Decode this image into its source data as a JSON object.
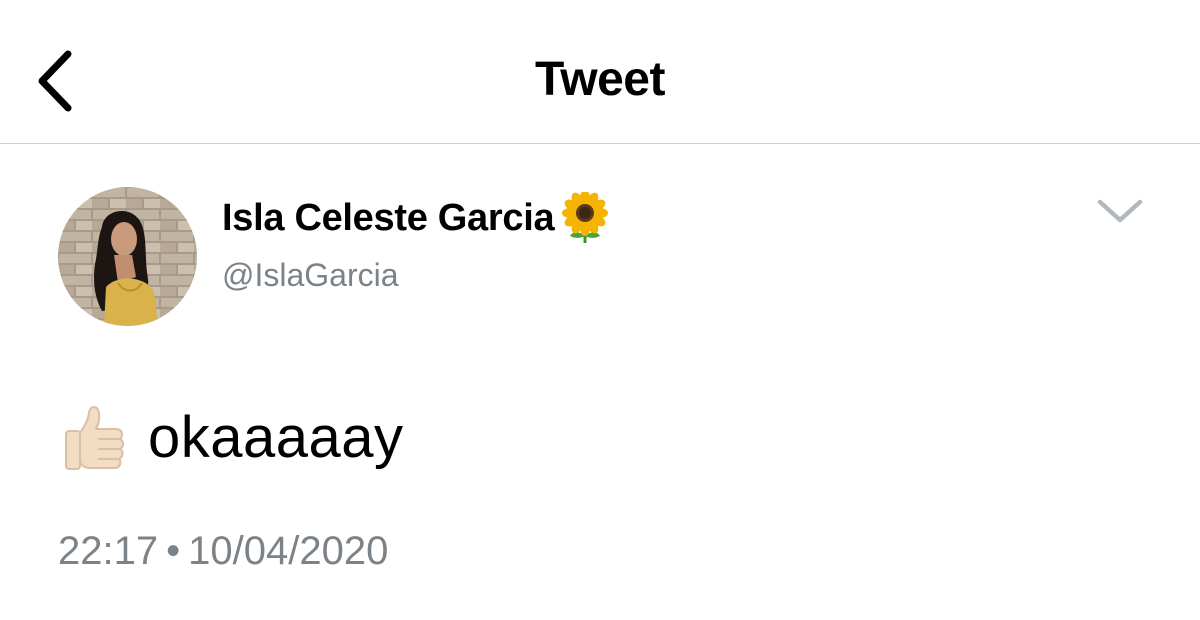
{
  "header": {
    "back_icon": "chevron-left-icon",
    "title": "Tweet"
  },
  "tweet": {
    "author": {
      "display_name": "Isla Celeste Garcia",
      "name_emoji": "sunflower-emoji",
      "handle": "@IslaGarcia",
      "avatar": "profile-photo"
    },
    "more_icon": "chevron-down-icon",
    "text_emoji": "thumbs-up-emoji",
    "text": "okaaaaay",
    "time": "22:17",
    "separator": "•",
    "date": "10/04/2020"
  },
  "colors": {
    "secondary_text": "#7b8288",
    "divider": "#cfcfd4",
    "chevron": "#b3b8bd"
  }
}
